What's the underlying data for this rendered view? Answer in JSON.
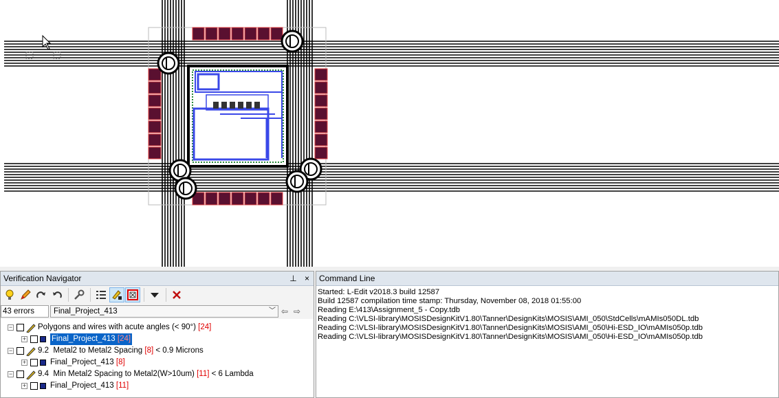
{
  "verification_navigator": {
    "title": "Verification Navigator",
    "pin_label": "📌",
    "close_label": "×",
    "error_count": "43 errors",
    "cell": "Final_Project_413",
    "toolbar_icons": [
      "bulb-icon",
      "pencil-icon",
      "redo-icon",
      "undo-icon",
      "wrench-icon",
      "list-icon",
      "highlight-icon",
      "zoom-error-icon",
      "dropdown-icon",
      "delete-icon"
    ],
    "rules": [
      {
        "prefix": "",
        "label": "Polygons and wires with acute angles (< 90°)",
        "count": "[24]",
        "suffix": "",
        "child": {
          "label": "Final_Project_413",
          "count": "[24]",
          "selected": true
        }
      },
      {
        "prefix": "9.2",
        "label": "Metal2 to Metal2 Spacing",
        "count": "[8]",
        "suffix": "< 0.9 Microns",
        "child": {
          "label": "Final_Project_413",
          "count": "[8]",
          "selected": false
        }
      },
      {
        "prefix": "9.4",
        "label": "Min Metal2 Spacing to Metal2(W>10um)",
        "count": "[11]",
        "suffix": "< 6 Lambda",
        "child": {
          "label": "Final_Project_413",
          "count": "[11]",
          "selected": false
        }
      }
    ]
  },
  "command_line": {
    "title": "Command Line",
    "lines": [
      "Started: L-Edit v2018.3 build 12587",
      "Build 12587 compilation time stamp: Thursday, November 08, 2018 01:55:00",
      "Reading E:\\413\\Assignment_5 - Copy.tdb",
      "Reading C:\\VLSI-library\\MOSISDesignKitV1.80\\Tanner\\DesignKits\\MOSIS\\AMI_050\\StdCells\\mAMIs050DL.tdb",
      "Reading C:\\VLSI-library\\MOSISDesignKitV1.80\\Tanner\\DesignKits\\MOSIS\\AMI_050\\Hi-ESD_IO\\mAMIs050p.tdb",
      "Reading C:\\VLSI-library\\MOSISDesignKitV1.80\\Tanner\\DesignKits\\MOSIS\\AMI_050\\Hi-ESD_IO\\mAMIs050p.tdb"
    ]
  },
  "colors": {
    "selection": "#0a64c8",
    "error_count": "#e00000",
    "panel_header": "#dfe6ee",
    "pad": "#5a1030",
    "metal": "#3a48e8"
  }
}
